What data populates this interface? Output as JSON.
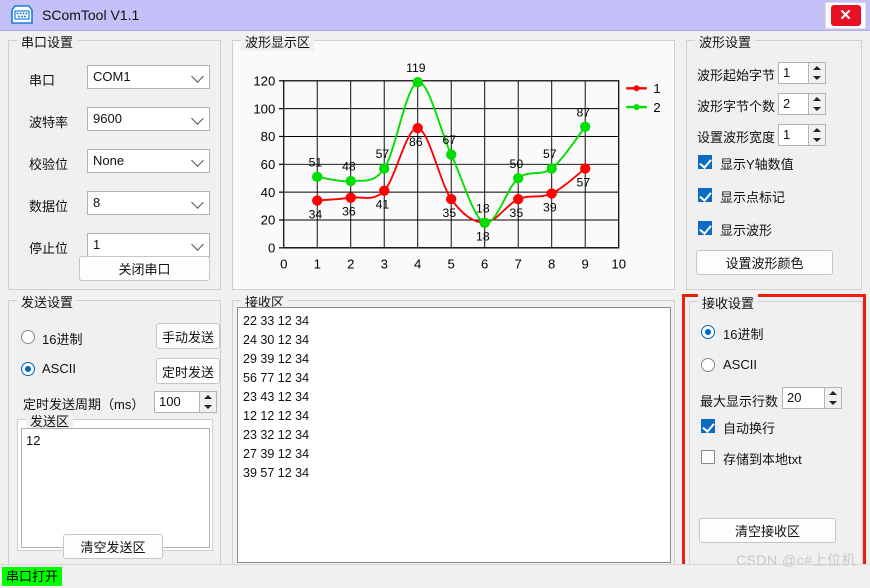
{
  "window": {
    "title": "SComTool V1.1",
    "icon": "serial-port-icon",
    "close_label": "✕",
    "titlebar_color": "#c3c1f7"
  },
  "serial_settings": {
    "legend": "串口设置",
    "fields": [
      {
        "label": "串口",
        "value": "COM1"
      },
      {
        "label": "波特率",
        "value": "9600"
      },
      {
        "label": "校验位",
        "value": "None"
      },
      {
        "label": "数据位",
        "value": "8"
      },
      {
        "label": "停止位",
        "value": "1"
      }
    ],
    "close_port_button": "关闭串口"
  },
  "send_settings": {
    "legend": "发送设置",
    "radio_hex": {
      "label": "16进制",
      "selected": false
    },
    "radio_ascii": {
      "label": "ASCII",
      "selected": true
    },
    "manual_send_button": "手动发送",
    "timed_send_button": "定时发送",
    "period_label": "定时发送周期（ms）",
    "period_value": "100",
    "send_area_legend": "发送区",
    "send_area_value": "12",
    "clear_send_button": "清空发送区"
  },
  "wave_display": {
    "legend": "波形显示区"
  },
  "receive_area": {
    "legend": "接收区",
    "lines": [
      "22 33 12 34",
      "24 30 12 34",
      "29 39 12 34",
      "56 77 12 34",
      "23 43 12 34",
      "12 12 12 34",
      "23 32 12 34",
      "27 39 12 34",
      "39 57 12 34"
    ]
  },
  "wave_settings": {
    "legend": "波形设置",
    "start_byte_label": "波形起始字节",
    "start_byte_value": "1",
    "byte_count_label": "波形字节个数",
    "byte_count_value": "2",
    "width_label": "设置波形宽度",
    "width_value": "1",
    "show_y_values": {
      "label": "显示Y轴数值",
      "checked": true
    },
    "show_point_marks": {
      "label": "显示点标记",
      "checked": true
    },
    "show_waveform": {
      "label": "显示波形",
      "checked": true
    },
    "set_color_button": "设置波形颜色"
  },
  "receive_settings": {
    "legend": "接收设置",
    "highlight_color": "#f01c10",
    "radio_hex": {
      "label": "16进制",
      "selected": true
    },
    "radio_ascii": {
      "label": "ASCII",
      "selected": false
    },
    "max_lines_label": "最大显示行数",
    "max_lines_value": "20",
    "auto_wrap": {
      "label": "自动换行",
      "checked": true
    },
    "save_local": {
      "label": "存储到本地txt",
      "checked": false
    },
    "clear_receive_button": "清空接收区"
  },
  "statusbar": {
    "port_status": "串口打开",
    "watermark": "CSDN @c#上位机"
  },
  "chart_data": {
    "type": "line",
    "title": "",
    "xlabel": "",
    "ylabel": "",
    "xlim": [
      0,
      10
    ],
    "ylim": [
      0,
      120
    ],
    "xticks": [
      0,
      1,
      2,
      3,
      4,
      5,
      6,
      7,
      8,
      9,
      10
    ],
    "yticks": [
      0,
      20,
      40,
      60,
      80,
      100,
      120
    ],
    "grid": true,
    "legend_position": "top-right",
    "show_point_labels": true,
    "markers": true,
    "x": [
      1,
      2,
      3,
      4,
      5,
      6,
      7,
      8,
      9
    ],
    "series": [
      {
        "name": "1",
        "color": "#ff0000",
        "values": [
          34,
          36,
          41,
          86,
          35,
          18,
          35,
          39,
          57
        ],
        "label_side": "below"
      },
      {
        "name": "2",
        "color": "#00dd00",
        "values": [
          51,
          48,
          57,
          119,
          67,
          18,
          50,
          57,
          87
        ],
        "label_side": "above"
      }
    ]
  }
}
